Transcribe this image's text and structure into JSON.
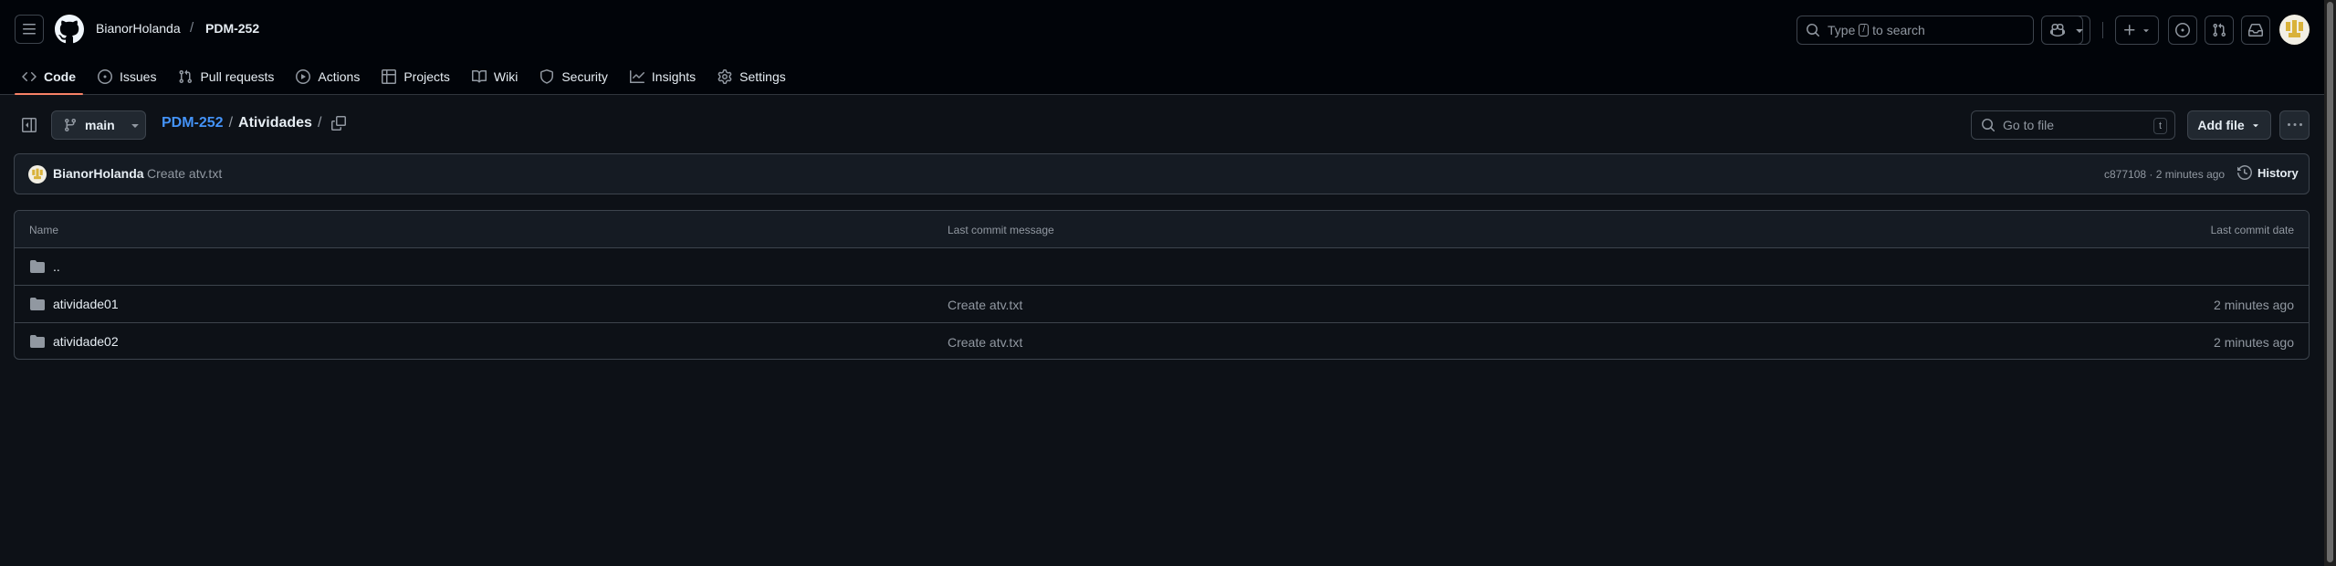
{
  "header": {
    "owner": "BianorHolanda",
    "separator": "/",
    "repo": "PDM-252",
    "search_prefix": "Type",
    "search_key": "/",
    "search_suffix": "to search"
  },
  "nav": {
    "tabs": [
      {
        "label": "Code",
        "icon": "code-icon",
        "active": true
      },
      {
        "label": "Issues",
        "icon": "issue-opened-icon"
      },
      {
        "label": "Pull requests",
        "icon": "git-pull-request-icon"
      },
      {
        "label": "Actions",
        "icon": "play-icon"
      },
      {
        "label": "Projects",
        "icon": "table-icon"
      },
      {
        "label": "Wiki",
        "icon": "book-icon"
      },
      {
        "label": "Security",
        "icon": "shield-icon"
      },
      {
        "label": "Insights",
        "icon": "graph-icon"
      },
      {
        "label": "Settings",
        "icon": "gear-icon"
      }
    ]
  },
  "toolbar": {
    "branch": "main",
    "crumb_repo": "PDM-252",
    "crumb_sep1": "/",
    "crumb_folder": "Atividades",
    "crumb_sep2": "/",
    "goto_placeholder": "Go to file",
    "goto_key": "t",
    "add_file": "Add file"
  },
  "commit": {
    "author": "BianorHolanda",
    "message": "Create atv.txt",
    "hash_time": "c877108 · 2 minutes ago",
    "history": "History"
  },
  "table": {
    "headers": {
      "name": "Name",
      "message": "Last commit message",
      "date": "Last commit date"
    },
    "rows": [
      {
        "name": "..",
        "message": "",
        "date": ""
      },
      {
        "name": "atividade01",
        "message": "Create atv.txt",
        "date": "2 minutes ago"
      },
      {
        "name": "atividade02",
        "message": "Create atv.txt",
        "date": "2 minutes ago"
      }
    ]
  },
  "colors": {
    "background": "#0d1117",
    "header": "#010409",
    "accent_link": "#4493f8",
    "active_tab_underline": "#f78166"
  }
}
